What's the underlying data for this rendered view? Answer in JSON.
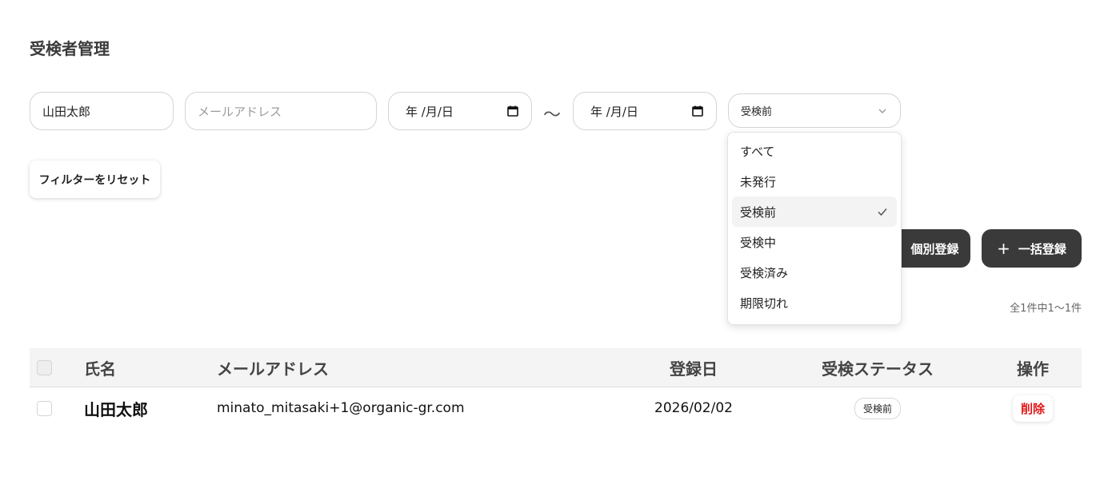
{
  "page": {
    "title": "受検者管理"
  },
  "filters": {
    "name_value": "山田太郎",
    "email_placeholder": "メールアドレス",
    "date_from": "年 /月/日",
    "date_separator": "〜",
    "date_to": "年 /月/日",
    "status_selected": "受検前",
    "status_options": [
      "すべて",
      "未発行",
      "受検前",
      "受検中",
      "受検済み",
      "期限切れ"
    ],
    "reset_label": "フィルターをリセット"
  },
  "actions": {
    "single_register_label": "個別登録",
    "bulk_register_label": "一括登録",
    "bulk_icon": "+"
  },
  "result_count": "全1件中1〜1件",
  "table": {
    "headers": {
      "name": "氏名",
      "email": "メールアドレス",
      "date": "登録日",
      "status": "受検ステータス",
      "actions": "操作"
    },
    "rows": [
      {
        "name": "山田太郎",
        "email": "minato_mitasaki+1@organic-gr.com",
        "date": "2026/02/02",
        "status": "受検前",
        "delete_label": "削除"
      }
    ]
  },
  "colors": {
    "dark_button": "#3a3a3a",
    "danger": "#e01818",
    "header_bg": "#f4f4f4"
  }
}
